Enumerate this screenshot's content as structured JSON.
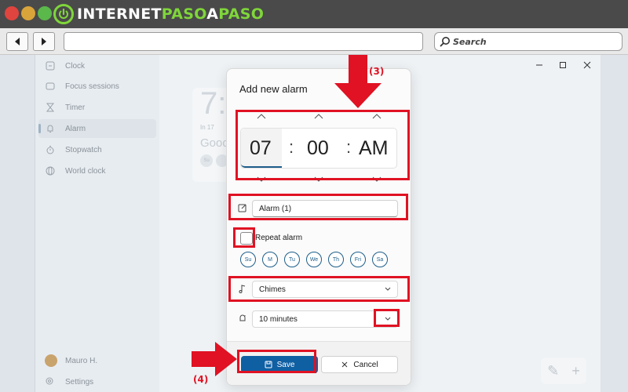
{
  "browser": {
    "logo": {
      "part1": "INTERNET",
      "part2": "PASO",
      "part3": "A",
      "part4": "PASO"
    },
    "search_label": "Search"
  },
  "app": {
    "sidebar": {
      "items": [
        {
          "label": "Clock",
          "icon": "clock-icon"
        },
        {
          "label": "Focus sessions",
          "icon": "focus-icon"
        },
        {
          "label": "Timer",
          "icon": "hourglass-icon"
        },
        {
          "label": "Alarm",
          "icon": "bell-icon"
        },
        {
          "label": "Stopwatch",
          "icon": "stopwatch-icon"
        },
        {
          "label": "World clock",
          "icon": "globe-icon"
        }
      ],
      "active_item": "Alarm",
      "profile_name": "Mauro H.",
      "settings_label": "Settings"
    },
    "background": {
      "clock_fragment": "7:",
      "sub_fragment": "In 17",
      "greeting_fragment": "Good",
      "chip": "Su"
    }
  },
  "dialog": {
    "title": "Add new alarm",
    "time": {
      "hour": "07",
      "minute": "00",
      "period": "AM",
      "separator": ":"
    },
    "alarm_name": "Alarm (1)",
    "repeat_label": "Repeat alarm",
    "repeat_checked": false,
    "days": [
      "Su",
      "M",
      "Tu",
      "We",
      "Th",
      "Fri",
      "Sa"
    ],
    "sound": "Chimes",
    "snooze": "10 minutes",
    "save_label": "Save",
    "cancel_label": "Cancel"
  },
  "annotations": {
    "step3": "(3)",
    "step4": "(4)"
  },
  "colors": {
    "accent": "#0f5fa3",
    "annotation": "#e01223",
    "logo_green": "#7fd63a"
  }
}
